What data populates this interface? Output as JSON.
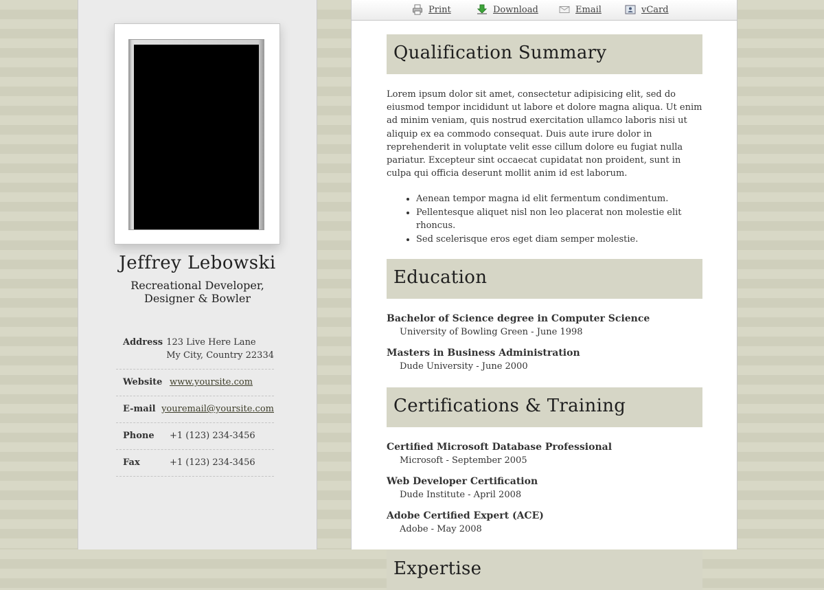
{
  "profile": {
    "name": "Jeffrey Lebowski",
    "title_line1": "Recreational Developer,",
    "title_line2": "Designer & Bowler"
  },
  "contact": {
    "address_label": "Address",
    "address_line1": "123 Live Here Lane",
    "address_line2": "My City, Country 22334",
    "website_label": "Website",
    "website": "www.yoursite.com",
    "email_label": "E-mail",
    "email": "youremail@yoursite.com",
    "phone_label": "Phone",
    "phone": "+1 (123) 234-3456",
    "fax_label": "Fax",
    "fax": "+1 (123) 234-3456"
  },
  "toolbar": {
    "print": "Print",
    "download": "Download",
    "email": "Email",
    "vcard": "vCard"
  },
  "sections": {
    "summary_heading": "Qualification Summary",
    "summary_text": "Lorem ipsum dolor sit amet, consectetur adipisicing elit, sed do eiusmod tempor incididunt ut labore et dolore magna aliqua. Ut enim ad minim veniam, quis nostrud exercitation ullamco laboris nisi ut aliquip ex ea commodo consequat. Duis aute irure dolor in reprehenderit in voluptate velit esse cillum dolore eu fugiat nulla pariatur. Excepteur sint occaecat cupidatat non proident, sunt in culpa qui officia deserunt mollit anim id est laborum.",
    "bullets": [
      "Aenean tempor magna id elit fermentum condimentum.",
      "Pellentesque aliquet nisl non leo placerat non molestie elit rhoncus.",
      "Sed scelerisque eros eget diam semper molestie."
    ],
    "education_heading": "Education",
    "education": [
      {
        "title": "Bachelor of Science degree in Computer Science",
        "sub": "University of Bowling Green - June 1998"
      },
      {
        "title": "Masters in Business Administration",
        "sub": "Dude University - June 2000"
      }
    ],
    "certs_heading": "Certifications & Training",
    "certs": [
      {
        "title": "Certified Microsoft Database Professional",
        "sub": "Microsoft - September 2005"
      },
      {
        "title": "Web Developer Certification",
        "sub": "Dude Institute - April 2008"
      },
      {
        "title": "Adobe Certified Expert (ACE)",
        "sub": "Adobe - May 2008"
      }
    ],
    "expertise_heading": "Expertise"
  },
  "colors": {
    "background": "#d6d6c4",
    "section_header": "#d6d6c6",
    "sidebar": "#ebebeb",
    "link": "#3e3e2a"
  }
}
